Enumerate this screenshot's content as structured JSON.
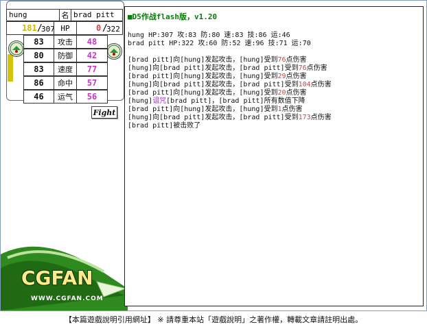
{
  "player1": {
    "name": "hung",
    "hp_current": "181",
    "hp_max": "307",
    "stats": [
      "83",
      "80",
      "83",
      "86",
      "46"
    ]
  },
  "player2": {
    "name": "brad pitt",
    "hp_current": "0",
    "hp_max": "322",
    "stats": [
      "48",
      "42",
      "77",
      "57",
      "56"
    ]
  },
  "labels": {
    "name": "名",
    "hp": "HP",
    "slash": "/",
    "stat_names": [
      "攻击",
      "防御",
      "速度",
      "命中",
      "运气"
    ],
    "fight": "Fight"
  },
  "logo": {
    "text": "CGFAN",
    "url": "WWW.CGFAN.COM"
  },
  "log": {
    "title": "■D5作战flash版，v1.20",
    "info": [
      "hung  HP:307 攻:83 防:80 速:83 技:86 运:46",
      "brad pitt  HP:322 攻:60 防:52 速:96 技:71 运:70"
    ],
    "entries": [
      {
        "a": "[brad pitt]向[hung]发起攻击，[hung]受到",
        "dmg": "76",
        "b": "点伤害"
      },
      {
        "a": "[hung]向[brad pitt]发起攻击，[brad pitt]受到",
        "dmg": "76",
        "b": "点伤害"
      },
      {
        "a": "[brad pitt]向[hung]发起攻击，[hung]受到",
        "dmg": "29",
        "b": "点伤害"
      },
      {
        "a": "[hung]向[brad pitt]发起攻击，[brad pitt]受到",
        "dmg": "104",
        "b": "点伤害"
      },
      {
        "a": "[brad pitt]向[hung]发起攻击，[hung]受到",
        "dmg": "20",
        "b": "点伤害"
      },
      {
        "pre": "[hung]",
        "curse": "诅咒",
        "post": "[brad pitt]，[brad pitt]所有数值下降"
      },
      {
        "a": "[brad pitt]向[hung]发起攻击，[hung]受到",
        "dmg": "1",
        "b": "点伤害"
      },
      {
        "a": "[hung]向[brad pitt]发起攻击，[brad pitt]受到",
        "dmg": "173",
        "b": "点伤害"
      },
      {
        "plain": "[brad pitt]被击败了"
      }
    ]
  },
  "footer": "【本篇遊戲說明引用網址】 ※ 請尊重本站「遊戲說明」之著作權，轉載文章請註明出處。",
  "colors": {
    "hp_p1": "#d2b400",
    "hp_p2": "#d43f3f",
    "pink": "#cc33cc",
    "title_green": "#0a7a0a",
    "damage": "#d43f3f",
    "curse": "#9b30c8"
  }
}
